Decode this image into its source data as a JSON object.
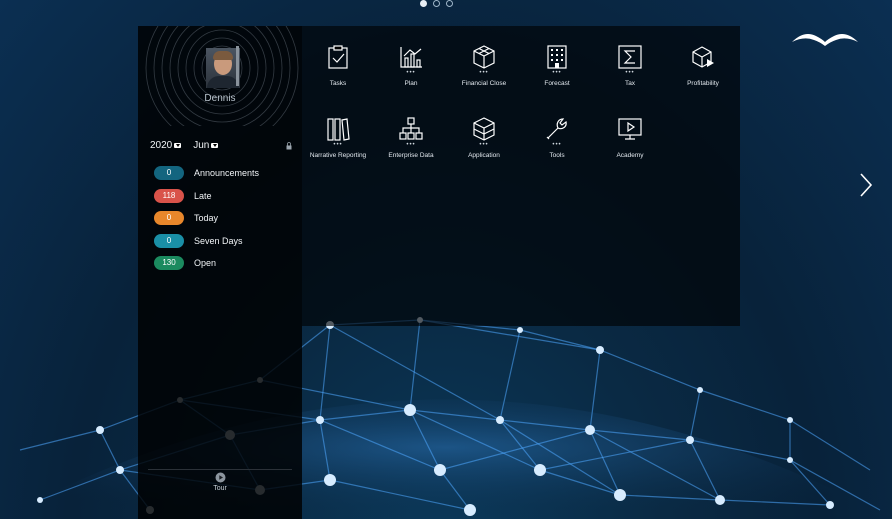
{
  "pagination": {
    "total": 3,
    "active": 0
  },
  "user": {
    "name": "Dennis"
  },
  "period": {
    "year": "2020",
    "month": "Jun"
  },
  "status_items": [
    {
      "count": "0",
      "label": "Announcements",
      "color": "#13657f"
    },
    {
      "count": "118",
      "label": "Late",
      "color": "#d9534a"
    },
    {
      "count": "0",
      "label": "Today",
      "color": "#e8872b"
    },
    {
      "count": "0",
      "label": "Seven Days",
      "color": "#1a8fa6"
    },
    {
      "count": "130",
      "label": "Open",
      "color": "#1b8a5f"
    }
  ],
  "tour": {
    "label": "Tour"
  },
  "tiles": [
    {
      "label": "Tasks",
      "icon": "clipboard-check-icon",
      "has_menu": false
    },
    {
      "label": "Plan",
      "icon": "bar-chart-icon",
      "has_menu": true
    },
    {
      "label": "Financial Close",
      "icon": "cube-icon",
      "has_menu": true
    },
    {
      "label": "Forecast",
      "icon": "building-icon",
      "has_menu": true
    },
    {
      "label": "Tax",
      "icon": "sigma-icon",
      "has_menu": true
    },
    {
      "label": "Profitability",
      "icon": "cube-arrow-icon",
      "has_menu": false
    },
    {
      "label": "Narrative Reporting",
      "icon": "books-icon",
      "has_menu": true
    },
    {
      "label": "Enterprise Data",
      "icon": "hierarchy-icon",
      "has_menu": true
    },
    {
      "label": "Application",
      "icon": "cube-icon",
      "has_menu": true
    },
    {
      "label": "Tools",
      "icon": "wrench-icon",
      "has_menu": true
    },
    {
      "label": "Academy",
      "icon": "monitor-play-icon",
      "has_menu": false
    }
  ],
  "menu_indicator": "•••"
}
